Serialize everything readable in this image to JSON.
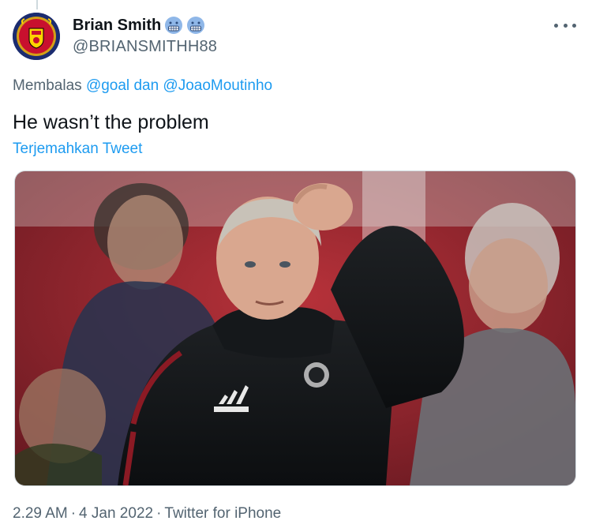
{
  "tweet": {
    "display_name": "Brian Smith",
    "handle": "@BRIANSMITHH88",
    "badge_icons": [
      "grimacing-face-icon",
      "grimacing-face-icon"
    ],
    "reply_prefix": "Membalas",
    "reply_mention_1": "@goal",
    "reply_joiner": "dan",
    "reply_mention_2": "@JoaoMoutinho",
    "text": "He wasn’t the problem",
    "translate_label": "Terjemahkan Tweet",
    "media_alt": "Photo of a man in a black training jacket scratching his head",
    "footer": {
      "time": "2.29 AM",
      "date": "4 Jan 2022",
      "source": "Twitter for iPhone"
    }
  },
  "colors": {
    "link": "#1d9bf0",
    "secondary_text": "#536471",
    "primary_text": "#0f1419"
  }
}
